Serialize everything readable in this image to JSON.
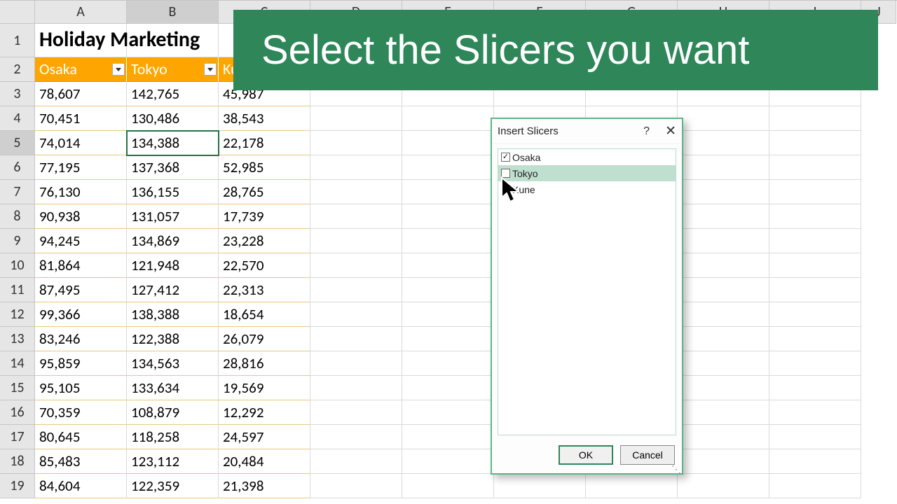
{
  "columns": [
    "A",
    "B",
    "C",
    "D",
    "E",
    "F",
    "G",
    "H",
    "I",
    "J"
  ],
  "selected_column_index": 1,
  "row_numbers": [
    1,
    2,
    3,
    4,
    5,
    6,
    7,
    8,
    9,
    10,
    11,
    12,
    13,
    14,
    15,
    16,
    17,
    18,
    19
  ],
  "selected_row_index": 4,
  "title_cell": "Holiday Marketing",
  "table_headers": [
    "Osaka",
    "Tokyo",
    "Kune"
  ],
  "active_cell": {
    "row_index": 4,
    "col_index": 1
  },
  "rows": [
    [
      "78,607",
      "142,765",
      "45,987"
    ],
    [
      "70,451",
      "130,486",
      "38,543"
    ],
    [
      "74,014",
      "134,388",
      "22,178"
    ],
    [
      "77,195",
      "137,368",
      "52,985"
    ],
    [
      "76,130",
      "136,155",
      "28,765"
    ],
    [
      "90,938",
      "131,057",
      "17,739"
    ],
    [
      "94,245",
      "134,869",
      "23,228"
    ],
    [
      "81,864",
      "121,948",
      "22,570"
    ],
    [
      "87,495",
      "127,412",
      "22,313"
    ],
    [
      "99,366",
      "138,388",
      "18,654"
    ],
    [
      "83,246",
      "122,388",
      "26,079"
    ],
    [
      "95,859",
      "134,563",
      "28,816"
    ],
    [
      "95,105",
      "133,634",
      "19,569"
    ],
    [
      "70,359",
      "108,879",
      "12,292"
    ],
    [
      "80,645",
      "118,258",
      "24,597"
    ],
    [
      "85,483",
      "123,112",
      "20,484"
    ],
    [
      "84,604",
      "122,359",
      "21,398"
    ]
  ],
  "banner_text": "Select the Slicers you want",
  "dialog": {
    "title": "Insert Slicers",
    "help_label": "?",
    "close_label": "✕",
    "items": [
      {
        "label": "Osaka",
        "checked": true,
        "highlight": false
      },
      {
        "label": "Tokyo",
        "checked": false,
        "highlight": true
      },
      {
        "label": "Kune",
        "checked": false,
        "highlight": false
      }
    ],
    "ok_label": "OK",
    "cancel_label": "Cancel"
  }
}
